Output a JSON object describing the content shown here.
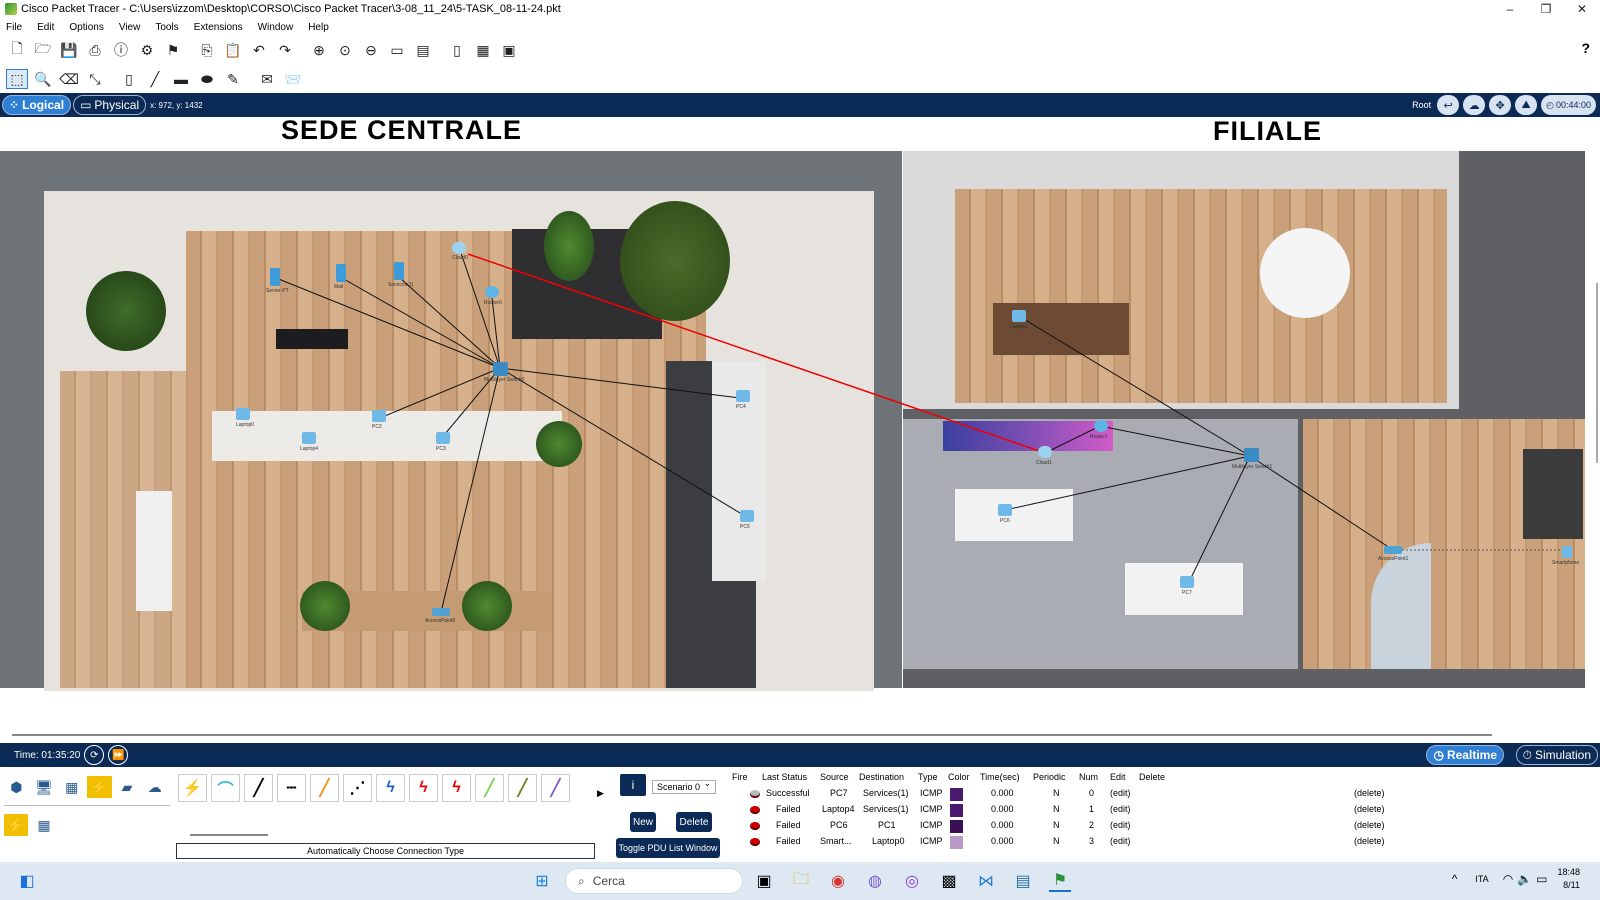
{
  "window": {
    "title": "Cisco Packet Tracer - C:\\Users\\izzom\\Desktop\\CORSO\\Cisco Packet Tracer\\3-08_11_24\\5-TASK_08-11-24.pkt",
    "minimize": "–",
    "maximize": "❐",
    "close": "✕"
  },
  "menu": [
    "File",
    "Edit",
    "Options",
    "View",
    "Tools",
    "Extensions",
    "Window",
    "Help"
  ],
  "toolbar": {
    "help": "?"
  },
  "workspace": {
    "logical_label": "Logical",
    "physical_label": "Physical",
    "coords": "x: 972, y: 1432",
    "root_label": "Root",
    "clock": "00:44:00"
  },
  "canvas": {
    "title_left": "SEDE CENTRALE",
    "title_right": "FILIALE"
  },
  "devices": [
    {
      "id": "server1",
      "label": "Server-PT",
      "kind": "server"
    },
    {
      "id": "server2",
      "label": "Mail",
      "kind": "server"
    },
    {
      "id": "server3",
      "label": "Services(1)",
      "kind": "server"
    },
    {
      "id": "cloud0",
      "label": "Cloud0",
      "kind": "cloud"
    },
    {
      "id": "router0",
      "label": "Router0",
      "kind": "router"
    },
    {
      "id": "switch0",
      "label": "Multilayer Switch0",
      "kind": "switch"
    },
    {
      "id": "laptop0",
      "label": "Laptop0",
      "kind": "laptop"
    },
    {
      "id": "laptop4",
      "label": "Laptop4",
      "kind": "laptop"
    },
    {
      "id": "pc2",
      "label": "PC2",
      "kind": "pc"
    },
    {
      "id": "pc3",
      "label": "PC3",
      "kind": "pc"
    },
    {
      "id": "pc4",
      "label": "PC4",
      "kind": "pc"
    },
    {
      "id": "pc5",
      "label": "PC5",
      "kind": "pc"
    },
    {
      "id": "ap0",
      "label": "AccessPoint0",
      "kind": "ap"
    },
    {
      "id": "laptop1",
      "label": "Laptop1",
      "kind": "laptop"
    },
    {
      "id": "router1",
      "label": "Router1",
      "kind": "router"
    },
    {
      "id": "cloud1",
      "label": "Cloud1",
      "kind": "cloud"
    },
    {
      "id": "switch1",
      "label": "Multilayer Switch1",
      "kind": "switch"
    },
    {
      "id": "pc6",
      "label": "PC6",
      "kind": "pc"
    },
    {
      "id": "pc7",
      "label": "PC7",
      "kind": "pc"
    },
    {
      "id": "ap1",
      "label": "AccessPoint1",
      "kind": "ap"
    },
    {
      "id": "smartdev",
      "label": "Smartphone",
      "kind": "phone"
    }
  ],
  "simbar": {
    "time": "Time: 01:35:20",
    "realtime": "Realtime",
    "simulation": "Simulation"
  },
  "connection_panel": {
    "auto_label": "Automatically Choose Connection Type"
  },
  "scenario": {
    "info": "i",
    "selected": "Scenario 0",
    "new": "New",
    "delete": "Delete",
    "toggle": "Toggle PDU List Window"
  },
  "pdu_table": {
    "headers": [
      "Fire",
      "Last Status",
      "Source",
      "Destination",
      "Type",
      "Color",
      "Time(sec)",
      "Periodic",
      "Num",
      "Edit",
      "Delete"
    ],
    "rows": [
      {
        "status": "Successful",
        "source": "PC7",
        "dest": "Services(1)",
        "type": "ICMP",
        "color": "#4a1a6e",
        "time": "0.000",
        "periodic": "N",
        "num": "0",
        "edit": "(edit)",
        "delete": "(delete)"
      },
      {
        "status": "Failed",
        "source": "Laptop4",
        "dest": "Services(1)",
        "type": "ICMP",
        "color": "#4a1a6e",
        "time": "0.000",
        "periodic": "N",
        "num": "1",
        "edit": "(edit)",
        "delete": "(delete)"
      },
      {
        "status": "Failed",
        "source": "PC6",
        "dest": "PC1",
        "type": "ICMP",
        "color": "#3a0f55",
        "time": "0.000",
        "periodic": "N",
        "num": "2",
        "edit": "(edit)",
        "delete": "(delete)"
      },
      {
        "status": "Failed",
        "source": "Smart...",
        "dest": "Laptop0",
        "type": "ICMP",
        "color": "#b99ac9",
        "time": "0.000",
        "periodic": "N",
        "num": "3",
        "edit": "(edit)",
        "delete": "(delete)"
      }
    ]
  },
  "taskbar": {
    "search": "Cerca",
    "lang": "ITA",
    "time": "18:48",
    "date": "8/11"
  }
}
